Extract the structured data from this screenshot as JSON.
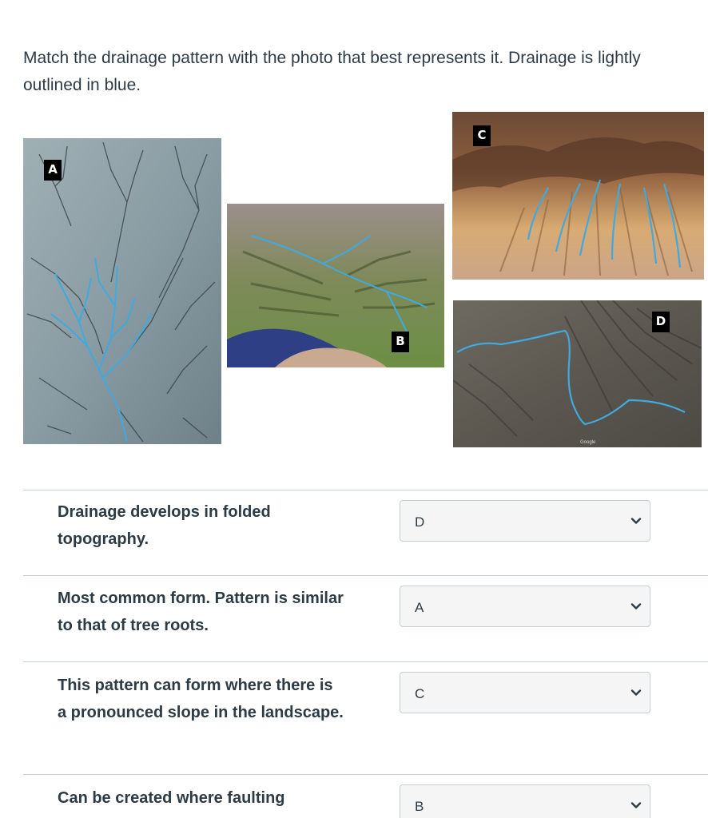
{
  "question": {
    "text": "Match the drainage pattern with the photo that best represents it. Drainage is lightly outlined in blue."
  },
  "photos": [
    {
      "tag": "A",
      "icon": "dendritic-drainage-aerial-photo"
    },
    {
      "tag": "B",
      "icon": "wetland-drainage-aerial-photo"
    },
    {
      "tag": "C",
      "icon": "badlands-slope-drainage-photo"
    },
    {
      "tag": "D",
      "icon": "folded-terrain-drainage-photo"
    }
  ],
  "watermark": "Google",
  "matches": [
    {
      "prompt": "Drainage develops in folded topography.",
      "selected": "D"
    },
    {
      "prompt": "Most common form. Pattern is similar to that of tree roots.",
      "selected": "A"
    },
    {
      "prompt": "This pattern can form where there is a pronounced slope in the landscape.",
      "selected": "C"
    },
    {
      "prompt": "Can be created where faulting",
      "selected": "B"
    }
  ],
  "colors": {
    "text": "#2d3b45",
    "drainage_blue": "#3fa9e0",
    "divider": "#c7cdd1",
    "select_bg": "#f5f5f5"
  }
}
